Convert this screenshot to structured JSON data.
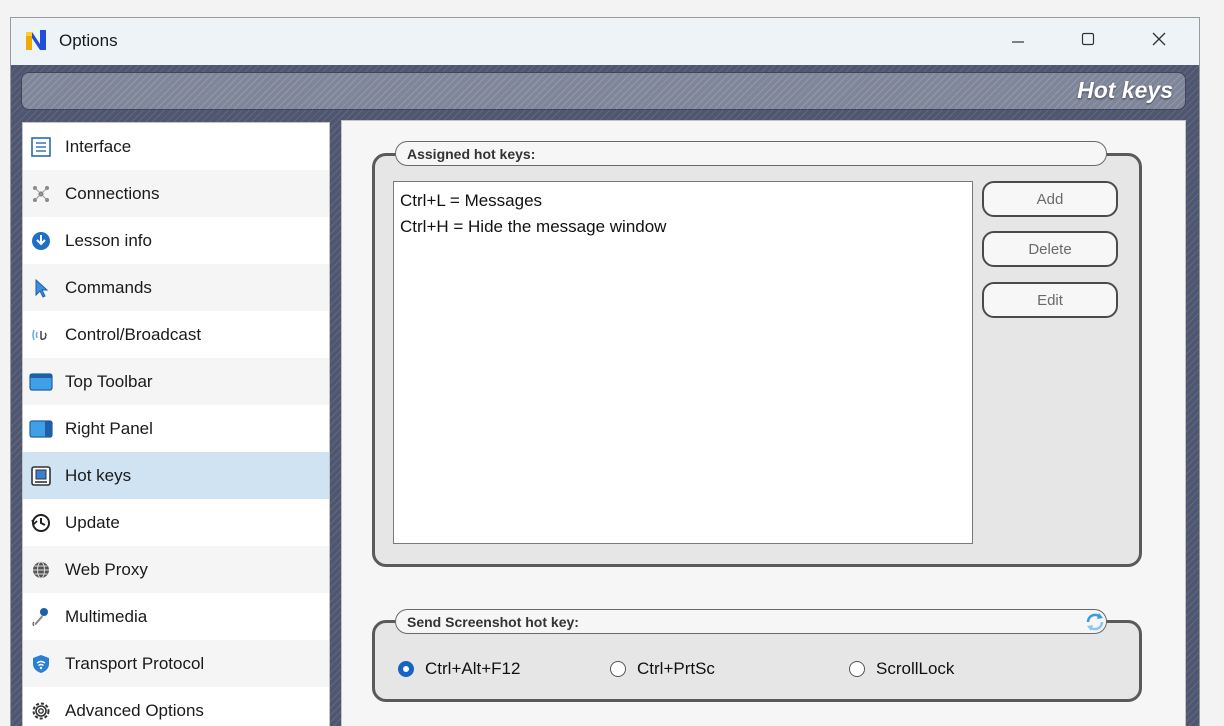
{
  "window": {
    "title": "Options",
    "app_icon": "netop-logo-icon",
    "controls": {
      "minimize": "minimize-icon",
      "maximize": "maximize-icon",
      "close": "close-icon"
    }
  },
  "header": {
    "title": "Hot keys"
  },
  "sidebar": {
    "selected": "Hot keys",
    "items": [
      {
        "label": "Interface",
        "icon": "interface-icon"
      },
      {
        "label": "Connections",
        "icon": "connections-icon"
      },
      {
        "label": "Lesson info",
        "icon": "download-icon"
      },
      {
        "label": "Commands",
        "icon": "cursor-icon"
      },
      {
        "label": "Control/Broadcast",
        "icon": "broadcast-icon"
      },
      {
        "label": "Top Toolbar",
        "icon": "top-toolbar-icon"
      },
      {
        "label": "Right Panel",
        "icon": "right-panel-icon"
      },
      {
        "label": "Hot keys",
        "icon": "hotkeys-icon"
      },
      {
        "label": "Update",
        "icon": "update-icon"
      },
      {
        "label": "Web Proxy",
        "icon": "globe-icon"
      },
      {
        "label": "Multimedia",
        "icon": "microphone-icon"
      },
      {
        "label": "Transport Protocol",
        "icon": "shield-icon"
      },
      {
        "label": "Advanced Options",
        "icon": "gear-icon"
      }
    ]
  },
  "assigned": {
    "label": "Assigned hot keys:",
    "hotkeys": [
      "Ctrl+L = Messages",
      "Ctrl+H = Hide the message window"
    ],
    "buttons": {
      "add": "Add",
      "delete": "Delete",
      "edit": "Edit"
    }
  },
  "screenshot": {
    "label": "Send Screenshot hot key:",
    "reset_icon": "refresh-icon",
    "selected": "Ctrl+Alt+F12",
    "options": [
      "Ctrl+Alt+F12",
      "Ctrl+PrtSc",
      "ScrollLock"
    ]
  },
  "colors": {
    "frame": "#4e5670",
    "selected_item": "#cfe3f2",
    "radio_accent": "#1565c0"
  }
}
